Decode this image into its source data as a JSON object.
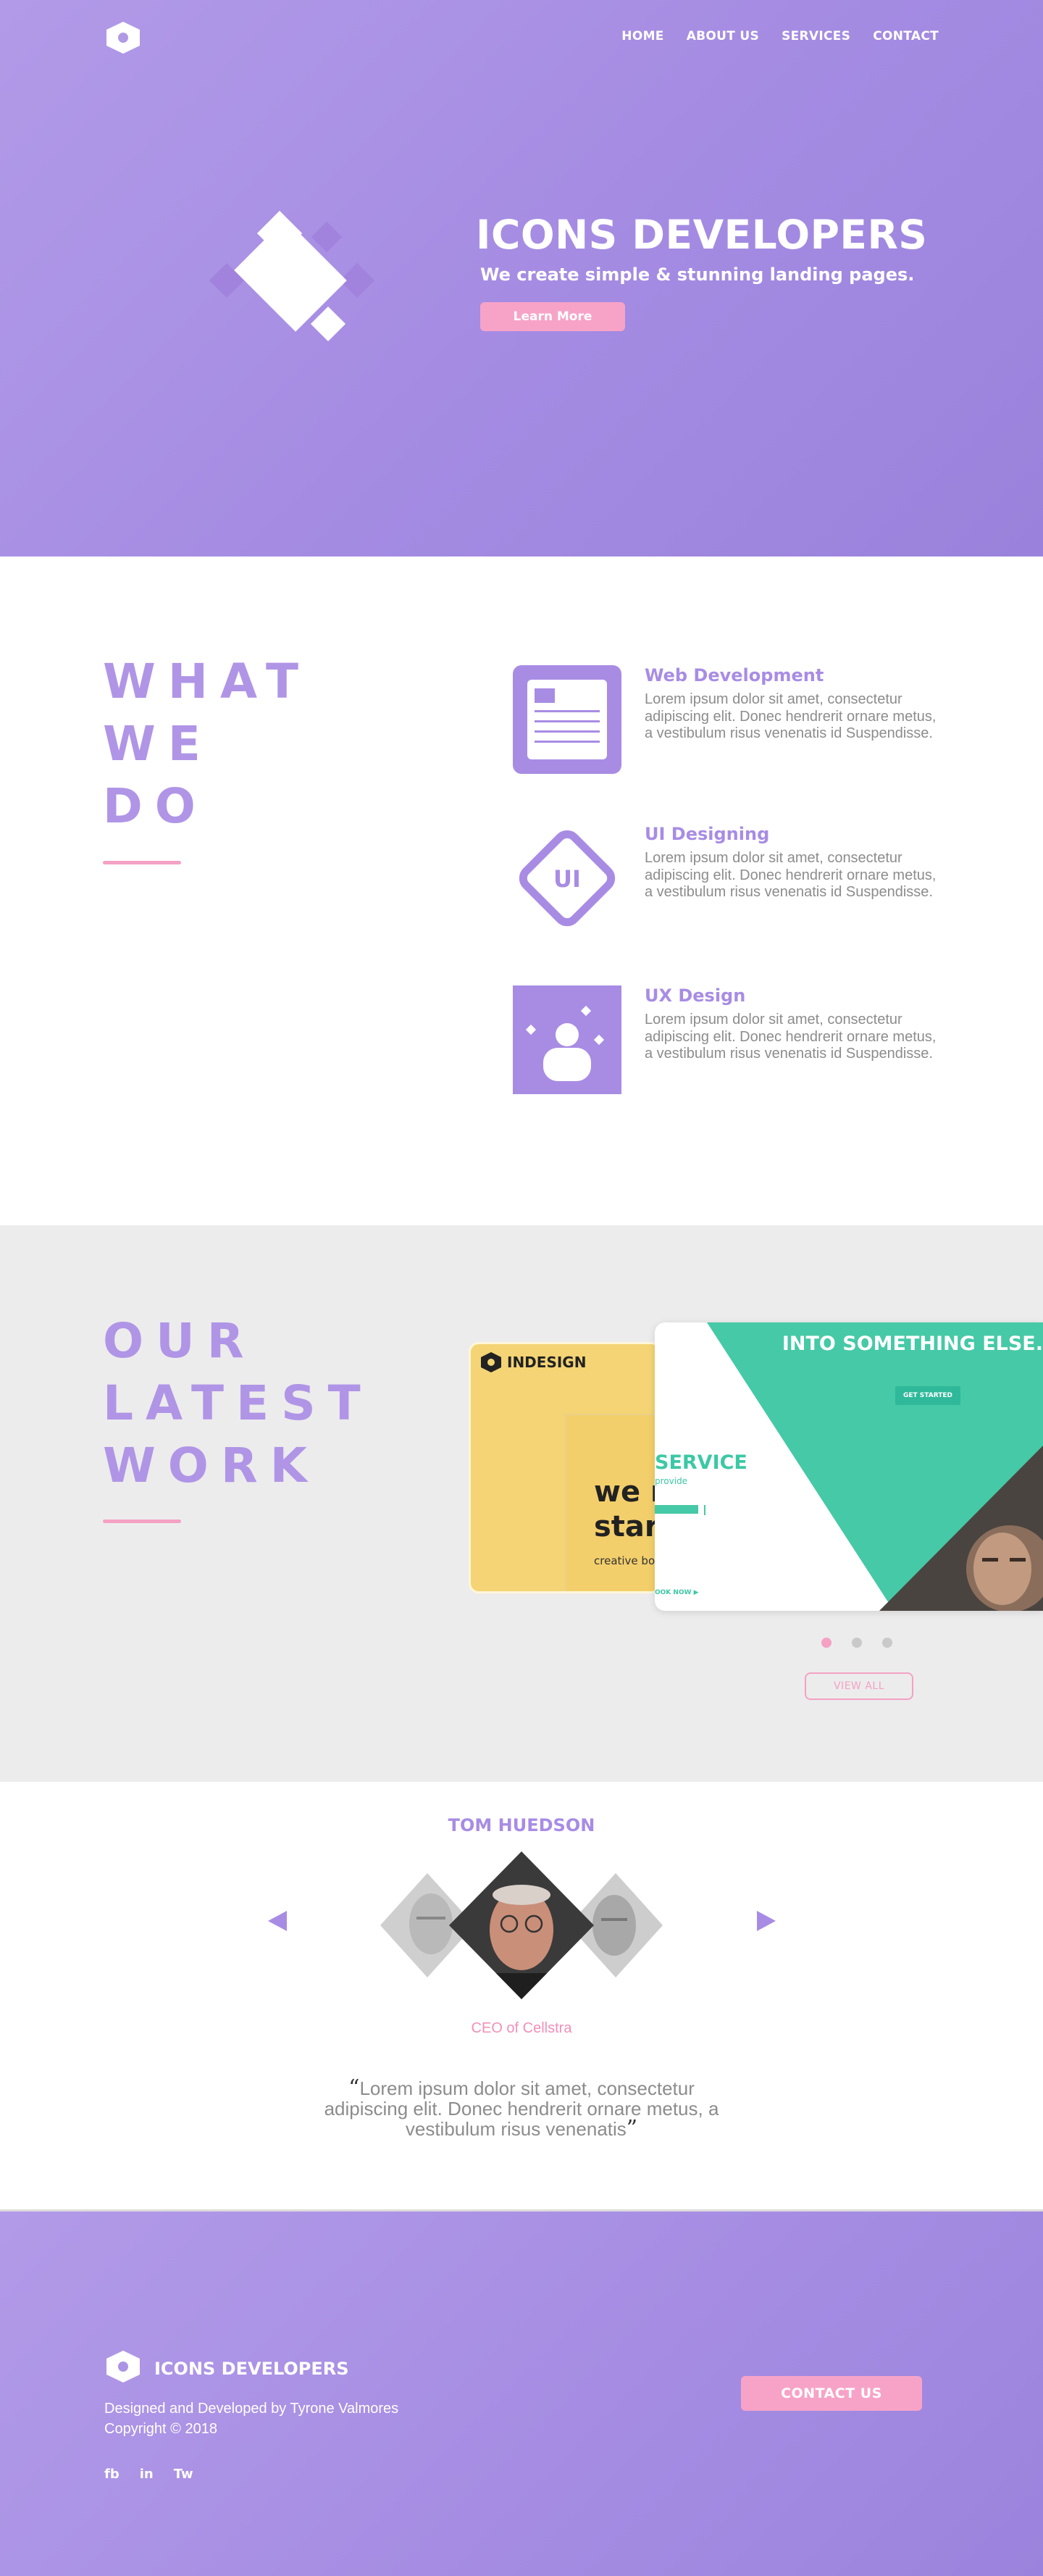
{
  "nav": {
    "items": [
      "HOME",
      "ABOUT US",
      "SERVICES",
      "CONTACT"
    ]
  },
  "hero": {
    "title": "ICONS DEVELOPERS",
    "subtitle": "We create simple & stunning landing pages.",
    "button_label": "Learn More"
  },
  "what_we_do": {
    "heading_lines": [
      "WHAT",
      "WE",
      "DO"
    ],
    "services": [
      {
        "title": "Web Development",
        "text": "Lorem ipsum dolor sit amet, consectetur adipiscing elit. Donec hendrerit ornare metus, a vestibulum risus  venenatis id Suspendisse.",
        "icon": "web-page-icon"
      },
      {
        "title": "UI Designing",
        "text": "Lorem ipsum dolor sit amet, consectetur adipiscing elit. Donec hendrerit ornare metus, a vestibulum risus  venenatis id Suspendisse.",
        "icon": "ui-diamond-icon",
        "icon_text": "UI"
      },
      {
        "title": "UX Design",
        "text": "Lorem ipsum dolor sit amet, consectetur adipiscing elit. Donec hendrerit ornare metus, a vestibulum risus  venenatis id Suspendisse.",
        "icon": "user-sparkle-icon"
      }
    ]
  },
  "latest_work": {
    "heading_lines": [
      "OUR",
      "LATEST",
      "WORK"
    ],
    "card_yellow": {
      "brand": "INDESIGN",
      "big_line_1": "we r",
      "big_line_2": "star",
      "small": "creative bo"
    },
    "card_green": {
      "title": "INTO SOMETHING ELSE.",
      "button": "GET STARTED",
      "service": "SERVICE",
      "provide": "provide",
      "book_now": "OOK NOW ▶"
    },
    "view_all_label": "VIEW ALL",
    "active_slide": 1,
    "slide_count": 3
  },
  "testimonial": {
    "name": "TOM HUEDSON",
    "role": "CEO of Cellstra",
    "quote": "Lorem ipsum dolor sit amet, consectetur adipiscing elit. Donec hendrerit ornare metus, a vestibulum risus  venenatis",
    "open_quote": "“",
    "close_quote": "”"
  },
  "footer": {
    "brand": "ICONS DEVELOPERS",
    "credit_line_1": "Designed and Developed by Tyrone Valmores",
    "credit_line_2": "Copyright © 2018",
    "social": [
      "fb",
      "in",
      "Tw"
    ],
    "contact_label": "CONTACT US"
  },
  "colors": {
    "brand_purple": "#a88ce4",
    "accent_pink": "#f7a3c8",
    "teal": "#3cc8a5",
    "work_bg": "#ececec"
  }
}
